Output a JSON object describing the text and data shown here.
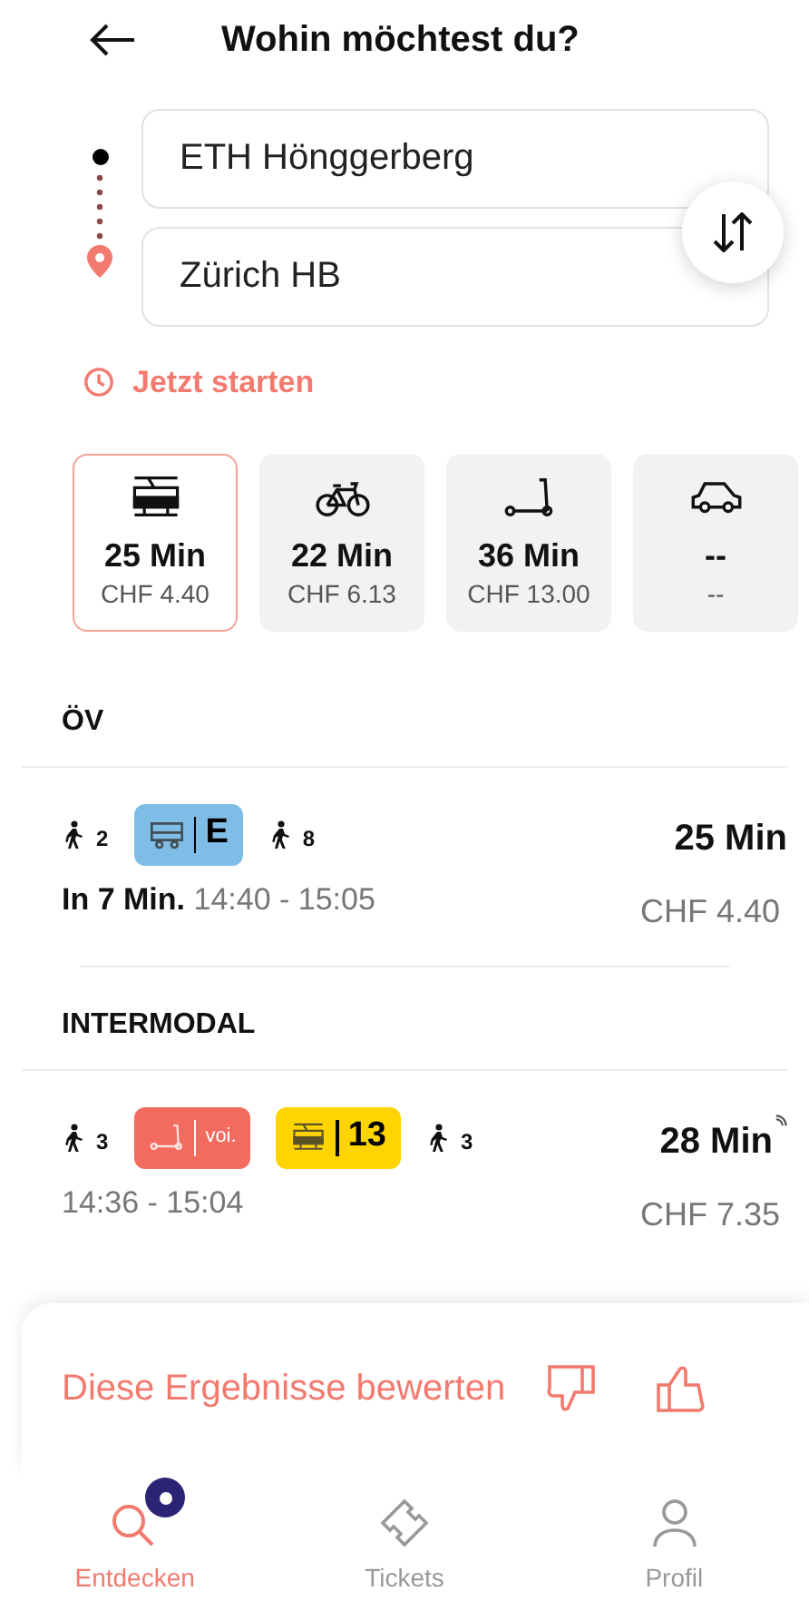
{
  "header": {
    "title": "Wohin möchtest du?"
  },
  "route": {
    "from": "ETH Hönggerberg",
    "to": "Zürich HB"
  },
  "time_option": "Jetzt starten",
  "modes": [
    {
      "kind": "tram",
      "duration": "25 Min",
      "price": "CHF 4.40",
      "selected": true
    },
    {
      "kind": "bike",
      "duration": "22 Min",
      "price": "CHF 6.13",
      "selected": false
    },
    {
      "kind": "scooter",
      "duration": "36 Min",
      "price": "CHF 13.00",
      "selected": false
    },
    {
      "kind": "car",
      "duration": "--",
      "price": "--",
      "selected": false
    }
  ],
  "sections": [
    {
      "title": "ÖV",
      "connections": [
        {
          "legs": [
            {
              "kind": "walk",
              "minutes": "2"
            },
            {
              "kind": "bus",
              "label": "E",
              "color": "#7fbde6"
            },
            {
              "kind": "walk",
              "minutes": "8"
            }
          ],
          "departure": "In 7 Min.",
          "times": "14:40 - 15:05",
          "duration": "25 Min",
          "realtime": false,
          "price": "CHF 4.40"
        }
      ]
    },
    {
      "title": "INTERMODAL",
      "connections": [
        {
          "legs": [
            {
              "kind": "walk",
              "minutes": "3"
            },
            {
              "kind": "scooter",
              "label": "voi.",
              "color": "#f26b5e"
            },
            {
              "kind": "tram",
              "label": "13",
              "color": "#ffd400"
            },
            {
              "kind": "walk",
              "minutes": "3"
            }
          ],
          "times": "14:36 - 15:04",
          "duration": "28 Min",
          "realtime": true,
          "price": "CHF 7.35"
        }
      ]
    }
  ],
  "feedback": {
    "text": "Diese Ergebnisse bewerten"
  },
  "nav": [
    {
      "kind": "discover",
      "label": "Entdecken",
      "selected": true,
      "badge": true
    },
    {
      "kind": "tickets",
      "label": "Tickets",
      "selected": false,
      "badge": false
    },
    {
      "kind": "profile",
      "label": "Profil",
      "selected": false,
      "badge": false
    }
  ]
}
